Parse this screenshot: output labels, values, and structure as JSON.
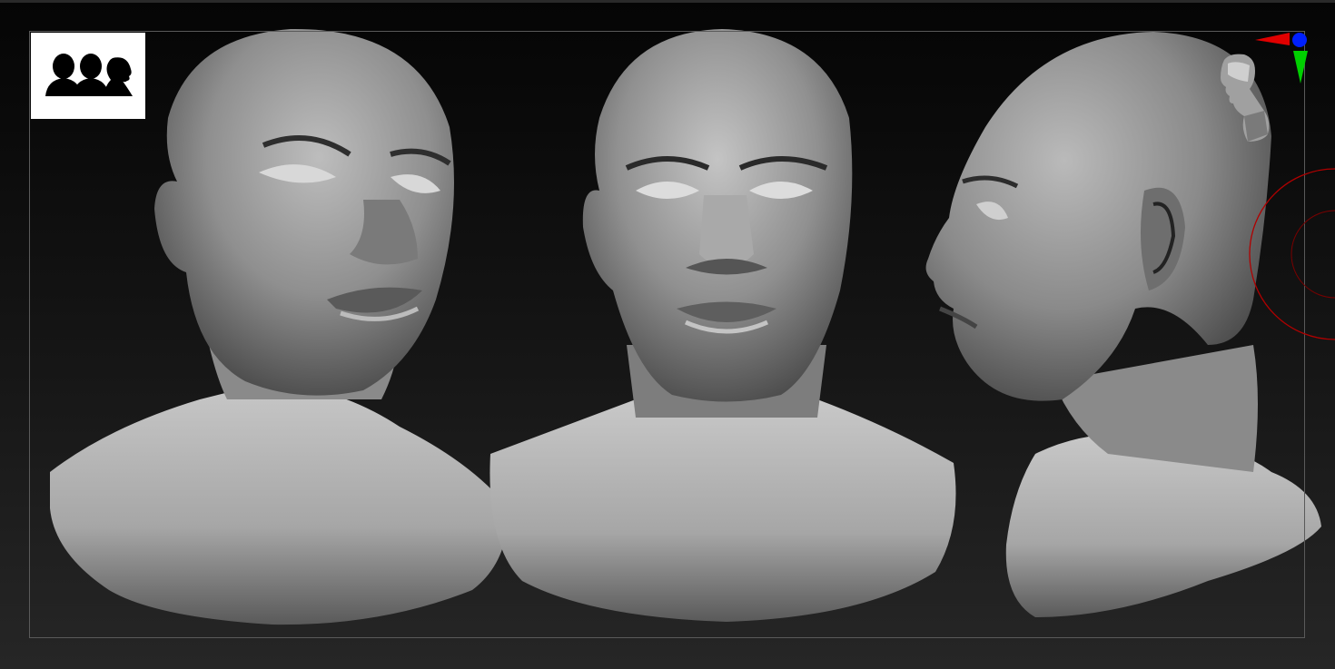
{
  "viewport": {
    "background_top": "#050505",
    "background_bottom": "#262626"
  },
  "icons": {
    "perspective_badge": "three-heads-icon",
    "orientation_gizmo": "axis-gizmo-icon",
    "head_thumbnail": "head-thumbnail-icon",
    "brush_cursor": "brush-circle-icon"
  },
  "colors": {
    "sculpt_material": "#9a9a9a",
    "gizmo_x": "#e00000",
    "gizmo_y": "#00d000",
    "gizmo_z": "#0020ff",
    "brush_cursor": "#b00000",
    "frame": "#5a5a5a"
  },
  "models": [
    {
      "view": "three-quarter"
    },
    {
      "view": "front"
    },
    {
      "view": "side"
    }
  ]
}
